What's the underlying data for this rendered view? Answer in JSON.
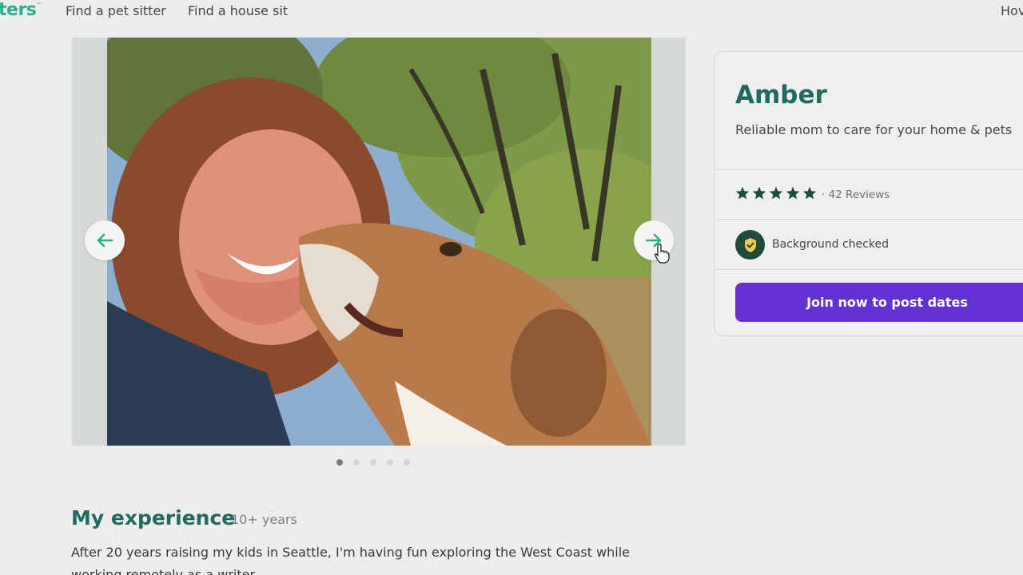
{
  "header": {
    "logo_text": "ters",
    "logo_mark": "™",
    "nav": [
      "Find a pet sitter",
      "Find a house sit",
      "Hov"
    ]
  },
  "gallery": {
    "photo_alt": "",
    "dot_count": 5,
    "active_dot": 0,
    "prev_icon": "arrow-left-icon",
    "next_icon": "arrow-right-icon"
  },
  "profile": {
    "name": "Amber",
    "tagline": "Reliable mom to care for your home & pets",
    "rating_stars": 5,
    "reviews": "· 42 Reviews",
    "badge": "Background checked",
    "cta": "Join now to post dates"
  },
  "experience": {
    "title": "My experience",
    "years": "10+ years",
    "body": "After 20 years raising my kids in Seattle, I'm having fun exploring the West Coast while working remotely as a writer."
  },
  "colors": {
    "brand_green": "#1f6b5f",
    "accent_teal": "#27b08e",
    "cta_purple": "#6331d1",
    "badge_dark": "#1f4a3c"
  }
}
